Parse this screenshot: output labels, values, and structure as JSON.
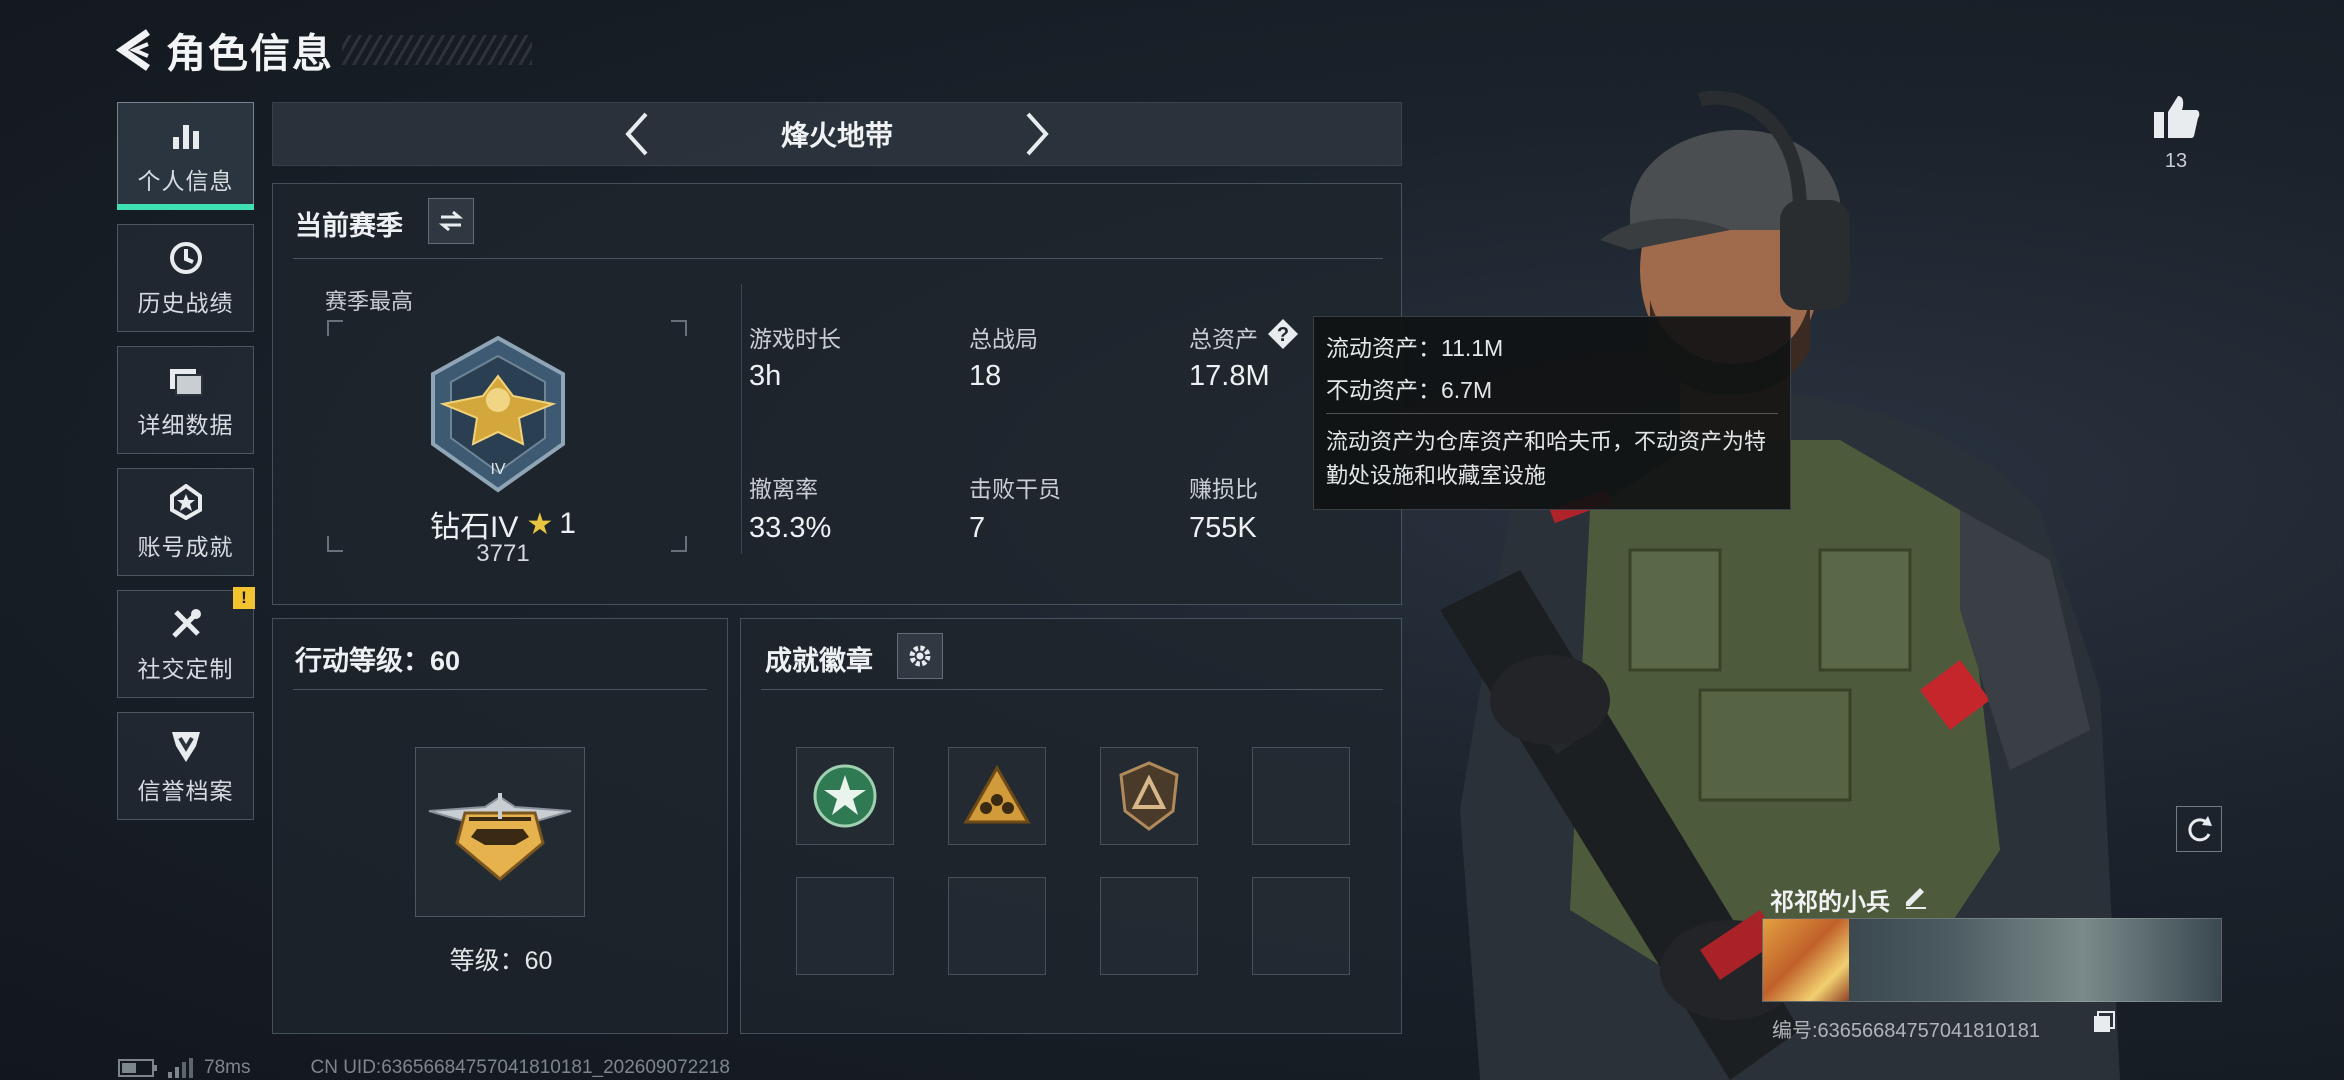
{
  "header": {
    "title": "角色信息"
  },
  "nav": {
    "items": [
      {
        "label": "个人信息",
        "active": true,
        "icon": "bar-chart-icon"
      },
      {
        "label": "历史战绩",
        "active": false,
        "icon": "history-clock-icon"
      },
      {
        "label": "详细数据",
        "active": false,
        "icon": "folder-icon"
      },
      {
        "label": "账号成就",
        "active": false,
        "icon": "achievement-medal-icon"
      },
      {
        "label": "社交定制",
        "active": false,
        "icon": "tools-icon",
        "badge": "!"
      },
      {
        "label": "信誉档案",
        "active": false,
        "icon": "reputation-icon"
      }
    ]
  },
  "mode": {
    "label": "烽火地带"
  },
  "season": {
    "title": "当前赛季",
    "best_label": "赛季最高",
    "rank_name": "钻石IV",
    "rank_stars": "1",
    "rank_score": "3771",
    "stats": [
      {
        "label": "游戏时长",
        "value": "3h"
      },
      {
        "label": "总战局",
        "value": "18"
      },
      {
        "label": "总资产",
        "value": "17.8M"
      },
      {
        "label": "撤离率",
        "value": "33.3%"
      },
      {
        "label": "击败干员",
        "value": "7"
      },
      {
        "label": "赚损比",
        "value": "755K"
      }
    ]
  },
  "tooltip": {
    "liquid": "流动资产：11.1M",
    "fixed": "不动资产：6.7M",
    "desc": "流动资产为仓库资产和哈夫币，不动资产为特勤处设施和收藏室设施"
  },
  "action_level": {
    "title": "行动等级：60",
    "level_text": "等级：60"
  },
  "achievements": {
    "title": "成就徽章",
    "badges": [
      "star-medal-icon",
      "team-triangle-icon",
      "bronze-shield-icon",
      "",
      "",
      "",
      "",
      ""
    ]
  },
  "profile": {
    "like_count": "13",
    "name": "祁祁的小兵",
    "id_text": "编号:6365668475704181018",
    "id_suffix": "1"
  },
  "status_bar": {
    "ping": "78ms",
    "uid": "CN UID:6365668475704181018‪1_202609072218"
  },
  "colors": {
    "accent": "#3ee0b4",
    "warning": "#f2c230"
  }
}
